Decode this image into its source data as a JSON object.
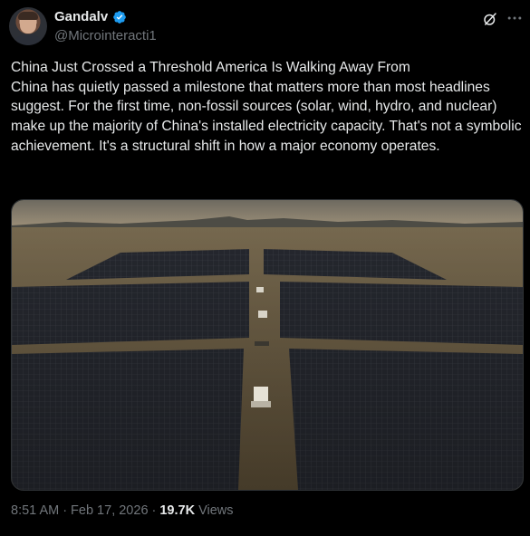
{
  "author": {
    "display_name": "Gandalv",
    "handle": "@Microinteracti1",
    "verified": true
  },
  "header_icons": [
    "grok-icon",
    "more-options-icon"
  ],
  "tweet": {
    "text": "China Just Crossed a Threshold America Is Walking Away From\nChina has quietly passed a milestone that matters more than most headlines suggest. For the first time, non-fossil sources (solar, wind, hydro, and nuclear) make up the majority of China's installed electricity capacity. That's not a symbolic achievement. It's a structural shift in how a major economy operates."
  },
  "media": {
    "type": "photo"
  },
  "footer": {
    "time": "8:51 AM",
    "separator1": "·",
    "date": "Feb 17, 2026",
    "separator2": "·",
    "views_count": "19.7K",
    "views_label": "Views"
  },
  "colors": {
    "background": "#000000",
    "text": "#e7e9ea",
    "muted": "#71767b",
    "verified_blue": "#1d9bf0"
  }
}
